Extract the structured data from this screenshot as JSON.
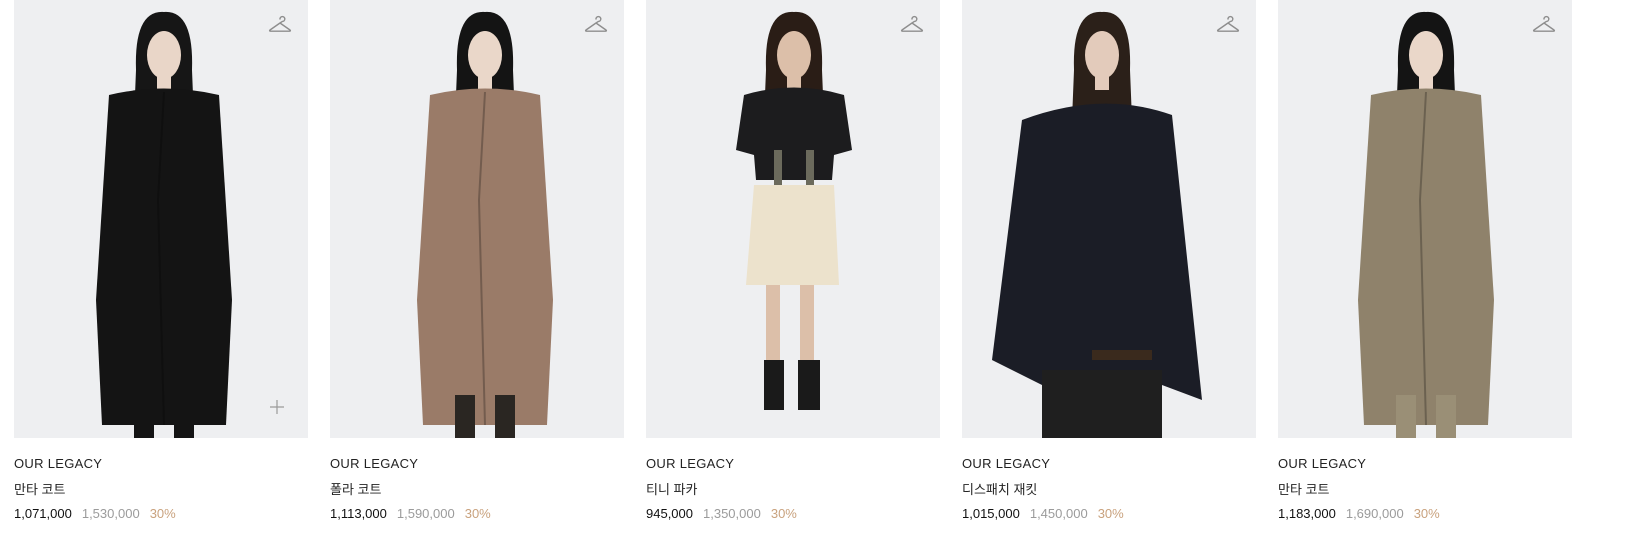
{
  "products": [
    {
      "brand": "OUR LEGACY",
      "name": "만타 코트",
      "price": "1,071,000",
      "original_price": "1,530,000",
      "discount": "30%",
      "wishlist_icon": "hanger-icon",
      "has_plus": true,
      "colors": {
        "garment": "#141414",
        "pants": "#141414",
        "hair": "#161616",
        "skin": "#e9d6c8"
      }
    },
    {
      "brand": "OUR LEGACY",
      "name": "폴라 코트",
      "price": "1,113,000",
      "original_price": "1,590,000",
      "discount": "30%",
      "wishlist_icon": "hanger-icon",
      "has_plus": false,
      "colors": {
        "garment": "#9a7b68",
        "pants": "#2a2622",
        "hair": "#141414",
        "skin": "#ead7c9"
      }
    },
    {
      "brand": "OUR LEGACY",
      "name": "티니 파카",
      "price": "945,000",
      "original_price": "1,350,000",
      "discount": "30%",
      "wishlist_icon": "hanger-icon",
      "has_plus": false,
      "colors": {
        "garment": "#1c1c1e",
        "pants": "#ece2cc",
        "hair": "#2a1d16",
        "skin": "#dcbfa9"
      }
    },
    {
      "brand": "OUR LEGACY",
      "name": "디스패치 재킷",
      "price": "1,015,000",
      "original_price": "1,450,000",
      "discount": "30%",
      "wishlist_icon": "hanger-icon",
      "has_plus": false,
      "colors": {
        "garment": "#1b1d26",
        "pants": "#1f1f1f",
        "hair": "#2b2019",
        "skin": "#e3cbbb"
      }
    },
    {
      "brand": "OUR LEGACY",
      "name": "만타 코트",
      "price": "1,183,000",
      "original_price": "1,690,000",
      "discount": "30%",
      "wishlist_icon": "hanger-icon",
      "has_plus": false,
      "colors": {
        "garment": "#8f826b",
        "pants": "#9a8f76",
        "hair": "#141414",
        "skin": "#ead7c9"
      }
    }
  ],
  "theme": {
    "price_color": "#111111",
    "original_price_color": "#9b9b9b",
    "discount_color": "#c9a27e",
    "photo_bg": "#eeeff1"
  }
}
